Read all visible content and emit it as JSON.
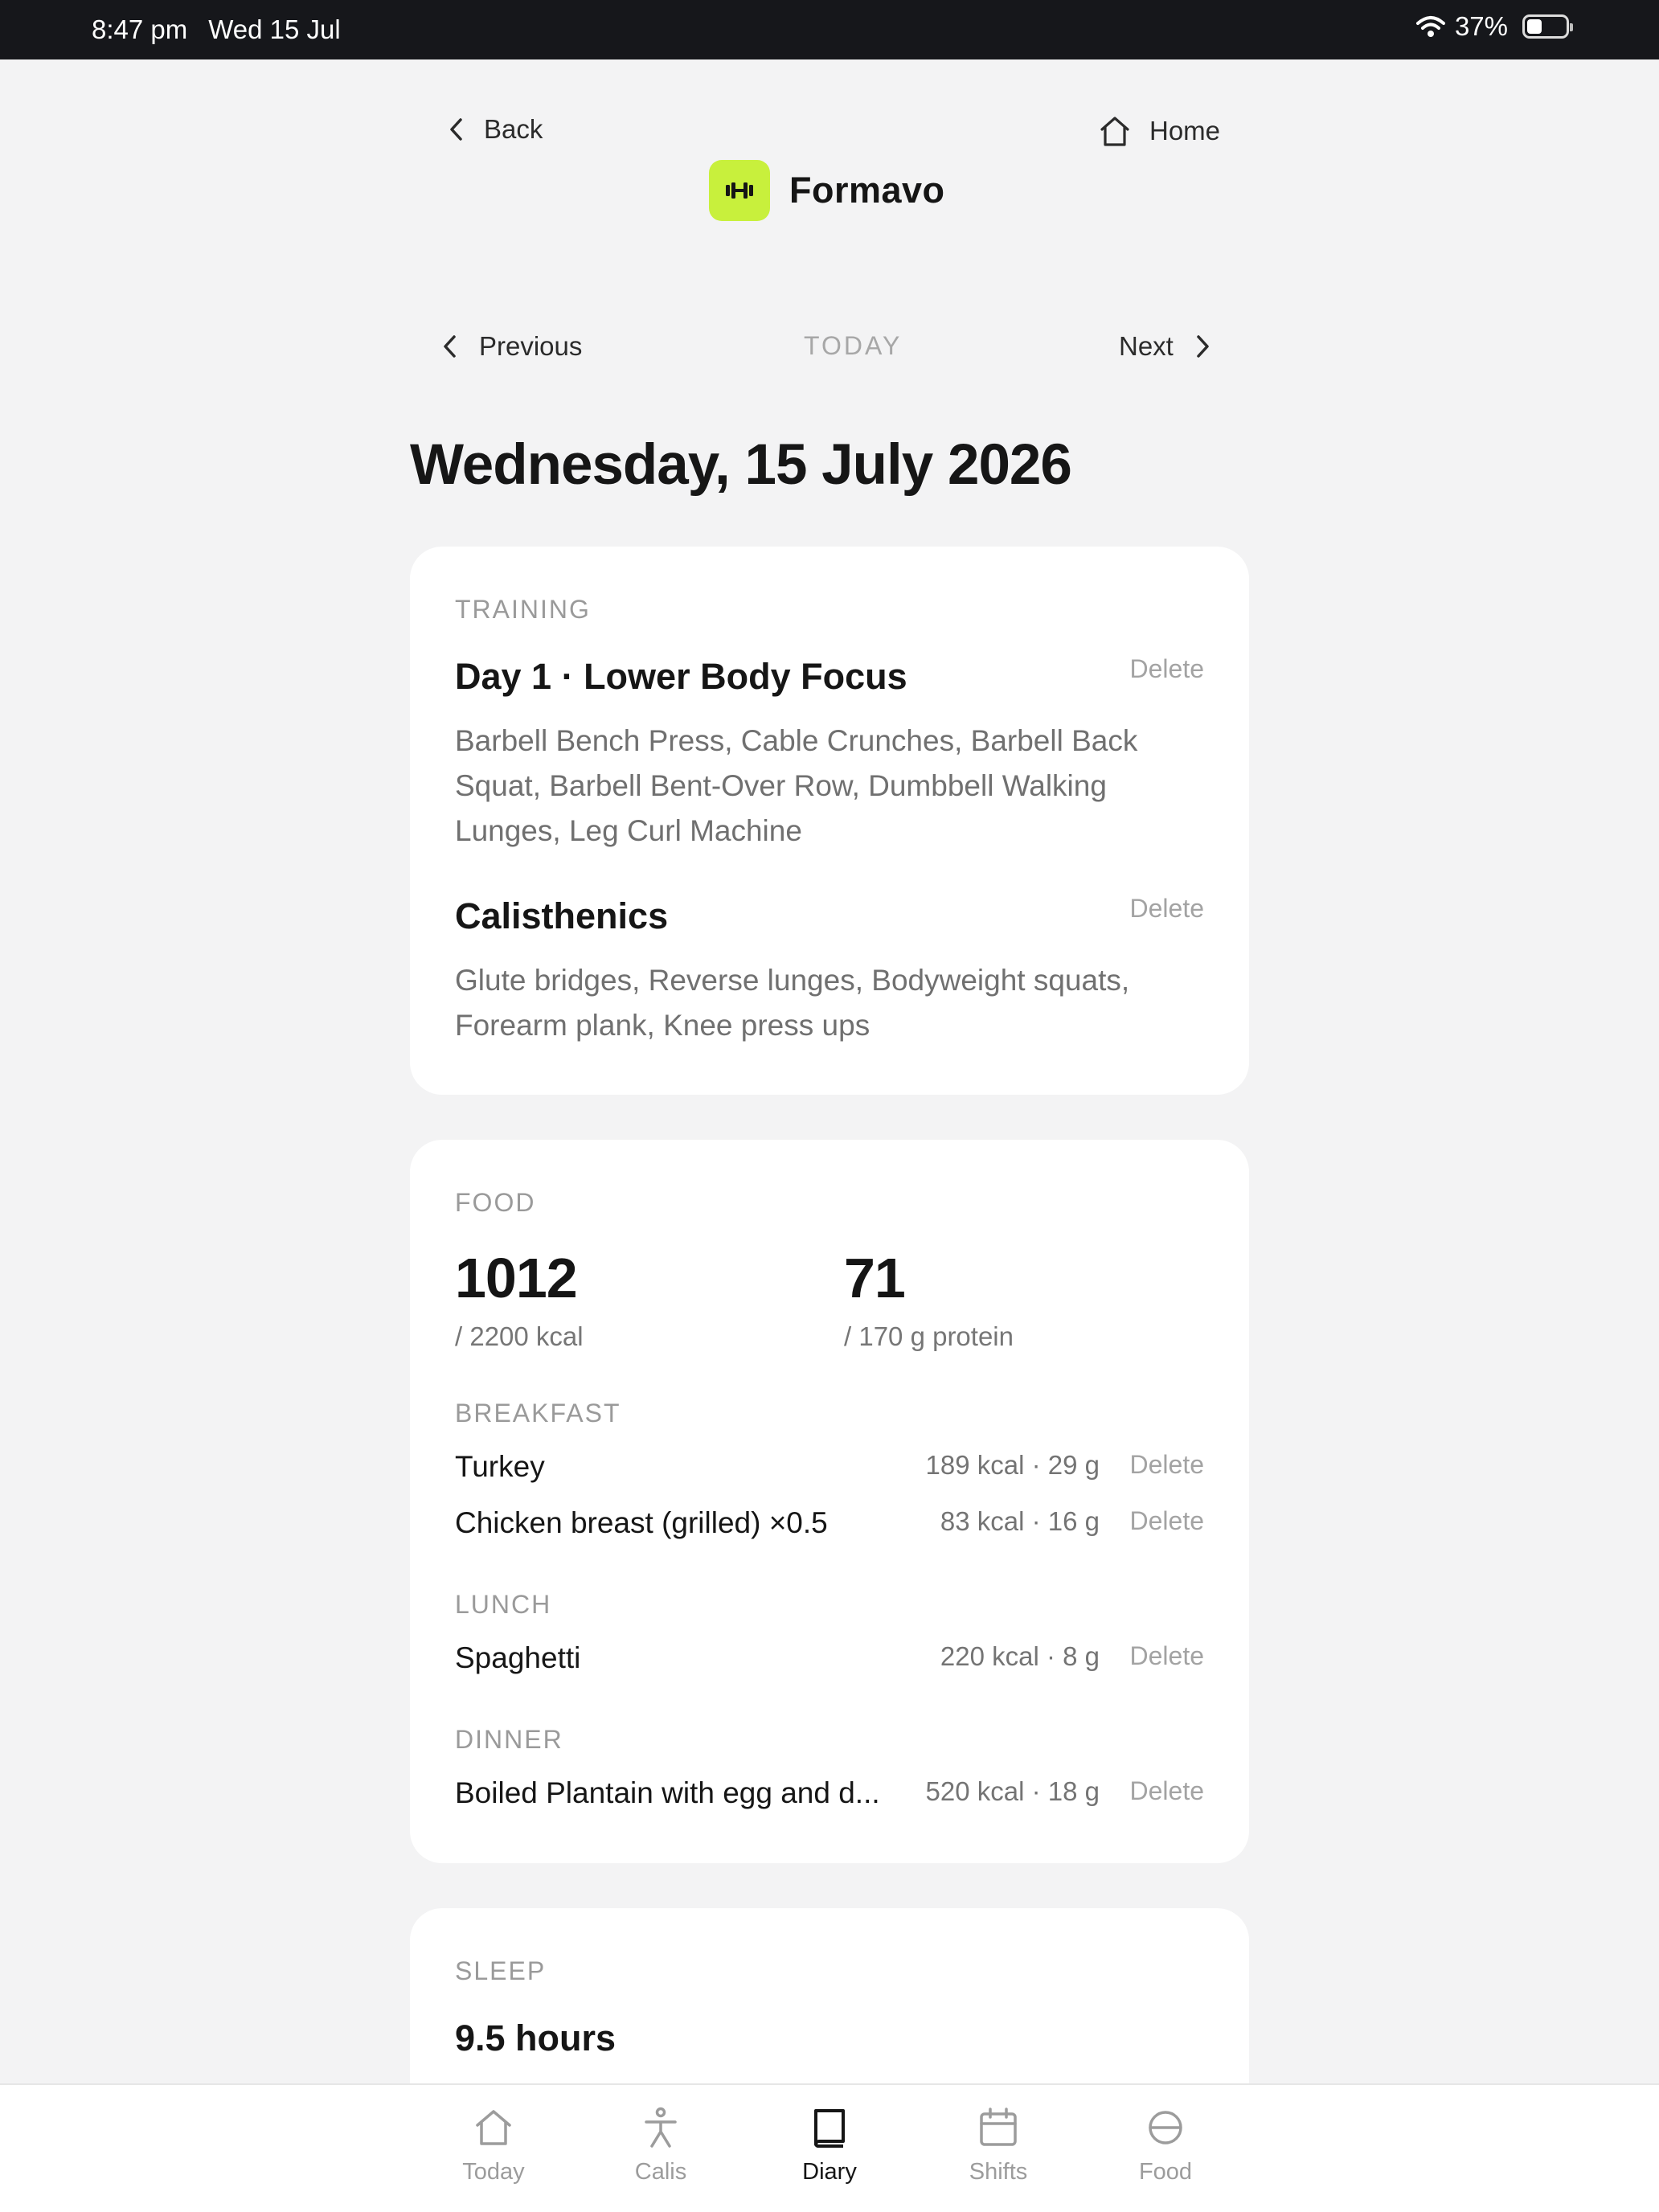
{
  "status_bar": {
    "time": "8:47 pm",
    "date": "Wed 15 Jul",
    "battery": "37%"
  },
  "header": {
    "back_label": "Back",
    "brand_name": "Formavo",
    "home_label": "Home"
  },
  "day_nav": {
    "previous_label": "Previous",
    "today_label": "TODAY",
    "next_label": "Next"
  },
  "date_title": "Wednesday, 15 July 2026",
  "training": {
    "section_label": "TRAINING",
    "entries": [
      {
        "title": "Day 1 · Lower Body Focus",
        "description": "Barbell Bench Press, Cable Crunches, Barbell Back Squat, Barbell Bent-Over Row, Dumbbell Walking Lunges, Leg Curl Machine",
        "delete_label": "Delete"
      },
      {
        "title": "Calisthenics",
        "description": "Glute bridges, Reverse lunges, Bodyweight squats, Forearm plank, Knee press ups",
        "delete_label": "Delete"
      }
    ]
  },
  "food": {
    "section_label": "FOOD",
    "kcal_value": "1012",
    "kcal_target": "/ 2200 kcal",
    "protein_value": "71",
    "protein_target": "/ 170 g protein",
    "meals": [
      {
        "label": "BREAKFAST",
        "items": [
          {
            "name": "Turkey",
            "macros": "189 kcal · 29 g",
            "delete_label": "Delete"
          },
          {
            "name": "Chicken breast (grilled) ×0.5",
            "macros": "83 kcal · 16 g",
            "delete_label": "Delete"
          }
        ]
      },
      {
        "label": "LUNCH",
        "items": [
          {
            "name": "Spaghetti",
            "macros": "220 kcal · 8 g",
            "delete_label": "Delete"
          }
        ]
      },
      {
        "label": "DINNER",
        "items": [
          {
            "name": "Boiled Plantain with egg and d...",
            "macros": "520 kcal · 18 g",
            "delete_label": "Delete"
          }
        ]
      }
    ]
  },
  "sleep": {
    "section_label": "SLEEP",
    "value": "9.5 hours"
  },
  "tab_bar": {
    "tabs": [
      {
        "label": "Today",
        "icon": "home-icon",
        "active": false
      },
      {
        "label": "Calis",
        "icon": "person-icon",
        "active": false
      },
      {
        "label": "Diary",
        "icon": "book-icon",
        "active": true
      },
      {
        "label": "Shifts",
        "icon": "calendar-icon",
        "active": false
      },
      {
        "label": "Food",
        "icon": "food-icon",
        "active": false
      }
    ]
  },
  "colors": {
    "accent": "#c8f03c",
    "background": "#f3f3f4",
    "card": "#ffffff",
    "muted": "#9a9a9a"
  }
}
